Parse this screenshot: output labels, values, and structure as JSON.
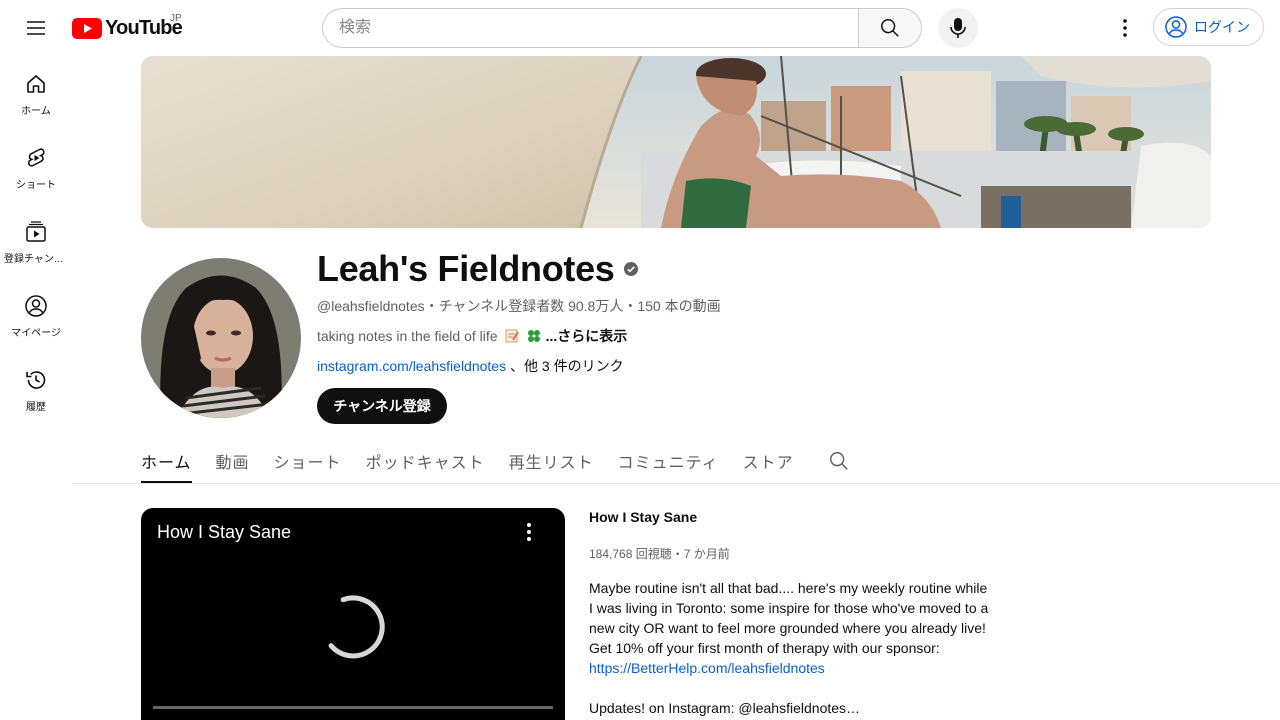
{
  "header": {
    "logo_text": "YouTube",
    "region": "JP",
    "search_placeholder": "検索",
    "login_label": "ログイン"
  },
  "sidebar": {
    "items": [
      {
        "label": "ホーム",
        "icon": "home-icon"
      },
      {
        "label": "ショート",
        "icon": "shorts-icon"
      },
      {
        "label": "登録チャンネル",
        "icon": "subscriptions-icon"
      },
      {
        "label": "マイページ",
        "icon": "my-page-icon"
      },
      {
        "label": "履歴",
        "icon": "history-icon"
      }
    ]
  },
  "channel": {
    "name": "Leah's Fieldnotes",
    "meta": "@leahsfieldnotes・チャンネル登録者数 90.8万人・150 本の動画",
    "description": "taking notes in the field of life",
    "more_label": "...さらに表示",
    "link": "instagram.com/leahsfieldnotes",
    "other_links": "、他 3 件のリンク",
    "subscribe_label": "チャンネル登録"
  },
  "tabs": [
    {
      "label": "ホーム",
      "active": true
    },
    {
      "label": "動画",
      "active": false
    },
    {
      "label": "ショート",
      "active": false
    },
    {
      "label": "ポッドキャスト",
      "active": false
    },
    {
      "label": "再生リスト",
      "active": false
    },
    {
      "label": "コミュニティ",
      "active": false
    },
    {
      "label": "ストア",
      "active": false
    }
  ],
  "featured": {
    "player_title": "How I Stay Sane",
    "title": "How I Stay Sane",
    "meta": "184,768 回視聴・7 か月前",
    "desc_lines": [
      "Maybe routine isn't all that bad.... here's my weekly routine while",
      "I was living in Toronto: some inspire for those who've moved to a",
      "new city OR want to feel more grounded where you already live!",
      "Get 10% off your first month of therapy with our sponsor:"
    ],
    "desc_url": "https://BetterHelp.com/leahsfieldnotes",
    "desc_last": "Updates! on Instagram: @leahsfieldnotes…"
  },
  "colors": {
    "brand_red": "#ff0000",
    "link_blue": "#065fd4",
    "text": "#0f0f0f",
    "secondary": "#606060"
  }
}
